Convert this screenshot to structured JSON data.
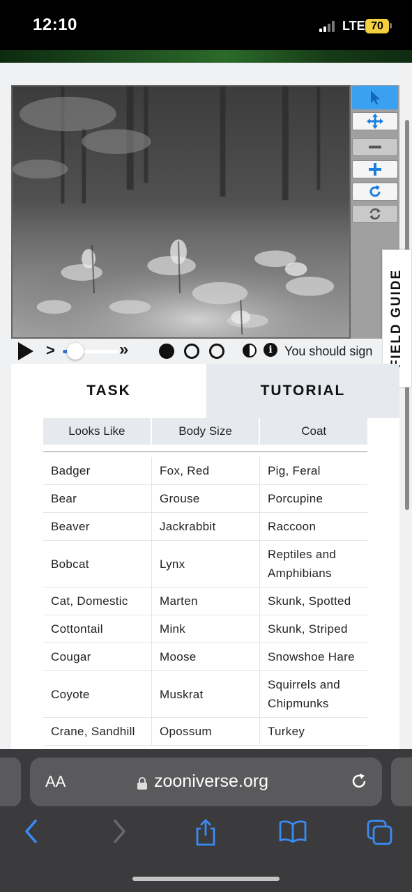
{
  "status_bar": {
    "time": "12:10",
    "network": "LTE",
    "battery": "70"
  },
  "viewer": {
    "image_alt": "Trail camera night infrared forest scene",
    "tools": [
      "pointer-icon",
      "move-icon",
      "zoom-out-icon",
      "zoom-in-icon",
      "rotate-icon",
      "reset-icon"
    ]
  },
  "field_guide": {
    "label": "FIELD GUIDE"
  },
  "controls": {
    "sign_in_text": "You should sign"
  },
  "tabs": {
    "task": "TASK",
    "tutorial": "TUTORIAL"
  },
  "filters": [
    "Looks Like",
    "Body Size",
    "Coat"
  ],
  "species_rows": [
    [
      "Badger",
      "Fox, Red",
      "Pig, Feral"
    ],
    [
      "Bear",
      "Grouse",
      "Porcupine"
    ],
    [
      "Beaver",
      "Jackrabbit",
      "Raccoon"
    ],
    [
      "Bobcat",
      "Lynx",
      "Reptiles and Amphibians"
    ],
    [
      "Cat, Domestic",
      "Marten",
      "Skunk, Spotted"
    ],
    [
      "Cottontail",
      "Mink",
      "Skunk, Striped"
    ],
    [
      "Cougar",
      "Moose",
      "Snowshoe Hare"
    ],
    [
      "Coyote",
      "Muskrat",
      "Squirrels and Chipmunks"
    ],
    [
      "Crane, Sandhill",
      "Opossum",
      "Turkey"
    ]
  ],
  "browser": {
    "aa_label": "AA",
    "url": "zooniverse.org"
  },
  "colors": {
    "accent": "#2b7bd6",
    "tool_active": "#3aa0f0",
    "safari_bg": "#3b3b3d"
  }
}
